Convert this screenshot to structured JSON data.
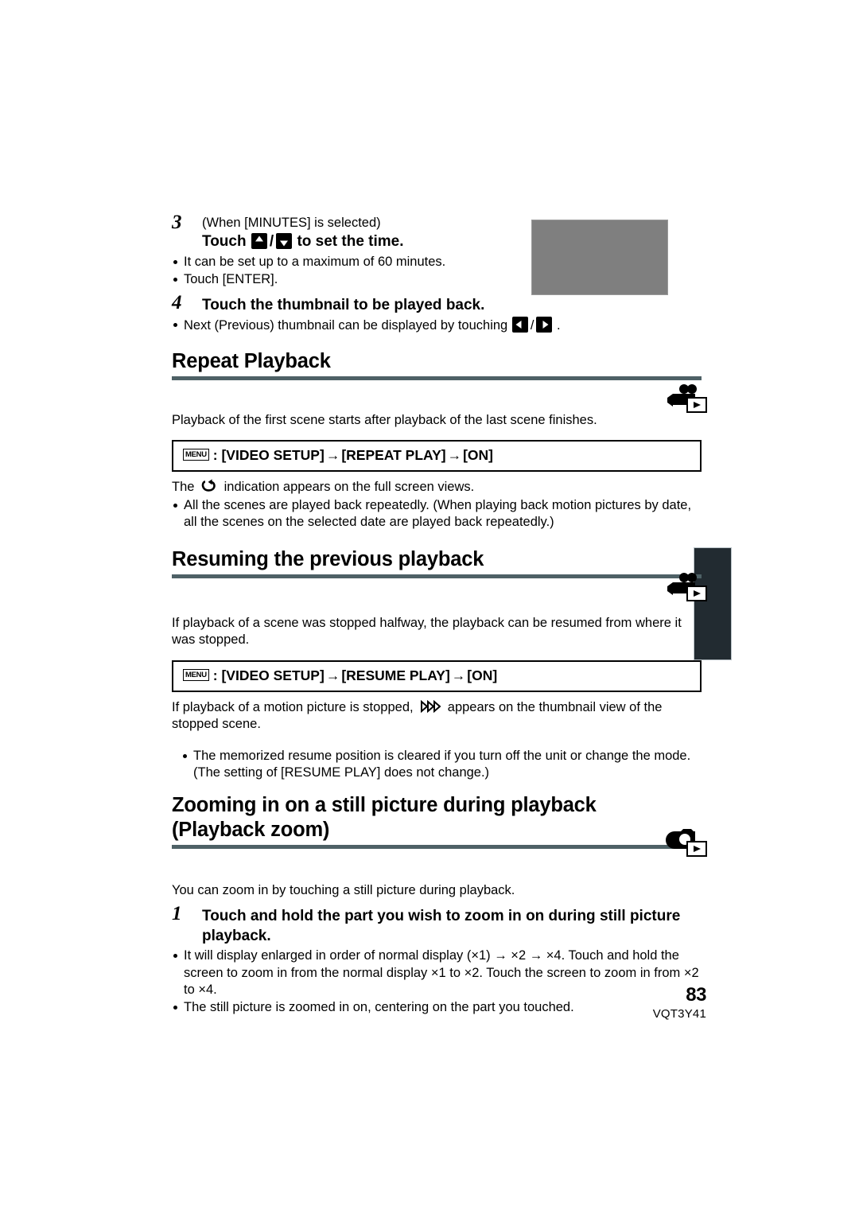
{
  "page": {
    "number": "83",
    "code": "VQT3Y41"
  },
  "steps": {
    "step3": {
      "number": "3",
      "condition": "(When [MINUTES] is selected)",
      "title_prefix": "Touch",
      "title_suffix": "to set the time.",
      "bullets": [
        "It can be set up to a maximum of 60 minutes.",
        "Touch [ENTER]."
      ],
      "icon_up": "triangle-up-button",
      "icon_down": "triangle-down-button"
    },
    "step4": {
      "number": "4",
      "title": "Touch the thumbnail to be played back.",
      "bullet_prefix": "Next (Previous) thumbnail can be displayed by touching",
      "bullet_suffix": ".",
      "icon_left": "triangle-left-button",
      "icon_right": "triangle-right-button"
    },
    "step1_zoom": {
      "number": "1",
      "title": "Touch and hold the part you wish to zoom in on during still picture playback.",
      "bullets": [
        "It will display enlarged in order of normal display (×1) → ×2 → ×4. Touch and hold the screen to zoom in from the normal display ×1 to ×2. Touch the screen to zoom in from ×2 to ×4.",
        "The still picture is zoomed in on, centering on the part you touched."
      ]
    }
  },
  "sections": [
    {
      "id": "repeat-playback",
      "heading": "Repeat Playback",
      "mode_icon": "video-camera-playback-icon",
      "intro": "Playback of the first scene starts after playback of the last scene finishes.",
      "menu_path": {
        "chip": "MENU",
        "colon": ":",
        "items": [
          "[VIDEO SETUP]",
          "[REPEAT PLAY]",
          "[ON]"
        ],
        "arrow": "→"
      },
      "indication_prefix": "The",
      "indication_suffix": "indication appears on the full screen views.",
      "indication_icon": "repeat-loop-icon",
      "bullets": [
        "All the scenes are played back repeatedly. (When playing back motion pictures by date, all the scenes on the selected date are played back repeatedly.)"
      ]
    },
    {
      "id": "resuming-previous-playback",
      "heading": "Resuming the previous playback",
      "mode_icon": "video-camera-playback-icon",
      "intro": "If playback of a scene was stopped halfway, the playback can be resumed from where it was stopped.",
      "menu_path": {
        "chip": "MENU",
        "colon": ":",
        "items": [
          "[VIDEO SETUP]",
          "[RESUME PLAY]",
          "[ON]"
        ],
        "arrow": "→"
      },
      "note_prefix": "If playback of a motion picture is stopped,",
      "note_suffix": "appears on the thumbnail view of the stopped scene.",
      "note_icon": "resume-play-icon",
      "bullets": [
        "The memorized resume position is cleared if you turn off the unit or change the mode. (The setting of [RESUME PLAY] does not change.)"
      ]
    },
    {
      "id": "playback-zoom",
      "heading_line1": "Zooming in on a still picture during playback",
      "heading_line2": "(Playback zoom)",
      "mode_icon": "still-camera-playback-icon",
      "intro": "You can zoom in by touching a still picture during playback."
    }
  ],
  "graphics": {
    "thumbnail_placeholder": "gray-image-placeholder",
    "edge_tab": "chapter-edge-tab"
  },
  "colors": {
    "rule": "#4e6166",
    "edge_tab": "#222b31",
    "placeholder": "#7f7f7f"
  }
}
